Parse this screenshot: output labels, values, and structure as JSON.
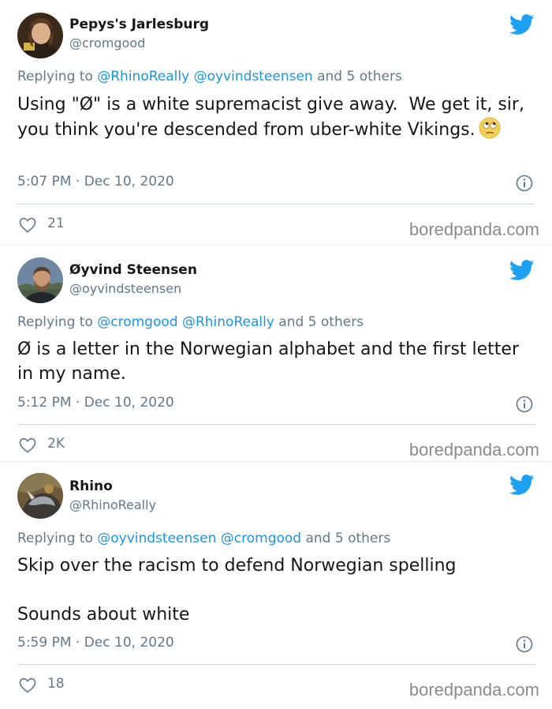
{
  "tweets": [
    {
      "name": "Pepys's Jarlesburg",
      "handle": "@cromgood",
      "reply_prefix": "Replying to ",
      "reply_mentions": "@RhinoReally @oyvindsteensen",
      "reply_suffix": " and 5 others",
      "text": "Using \"Ø\" is a white supremacist give away.  We get it, sir, you think you're descended from uber-white Vikings.",
      "emoji": "face-with-rolling-eyes",
      "time": "5:07 PM · Dec 10, 2020",
      "likes": "21",
      "watermark": "boredpanda.com"
    },
    {
      "name": "Øyvind Steensen",
      "handle": "@oyvindsteensen",
      "reply_prefix": "Replying to ",
      "reply_mentions": "@cromgood @RhinoReally",
      "reply_suffix": " and 5 others",
      "text": "Ø is a letter in the Norwegian alphabet and the first letter in my name.",
      "time": "5:12 PM · Dec 10, 2020",
      "likes": "2K",
      "watermark": "boredpanda.com"
    },
    {
      "name": "Rhino",
      "handle": "@RhinoReally",
      "reply_prefix": "Replying to ",
      "reply_mentions": "@oyvindsteensen @cromgood",
      "reply_suffix": " and 5 others",
      "text": "Skip over the racism to defend Norwegian spelling\n\nSounds about white",
      "time": "5:59 PM · Dec 10, 2020",
      "likes": "18",
      "watermark": "boredpanda.com"
    }
  ],
  "icons": {
    "brand": "twitter-bird-icon",
    "info": "info-icon",
    "like": "heart-icon"
  },
  "colors": {
    "twitter_blue": "#1da1f2",
    "mention_blue": "#1b95e0",
    "secondary_text": "#657786",
    "primary_text": "#14171a",
    "divider": "#ccd6dd"
  }
}
